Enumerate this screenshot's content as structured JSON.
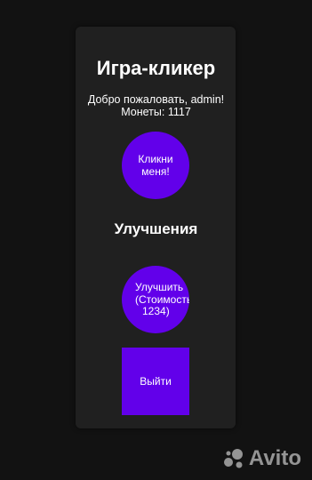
{
  "app": {
    "title": "Игра-кликер",
    "welcome": "Добро пожаловать, admin!",
    "coins_text": "Монеты: 1117"
  },
  "buttons": {
    "click_line1": "Кликни",
    "click_line2": "меня!",
    "upgrade_line1": "Улучшить",
    "upgrade_line2": "(Стоимость:",
    "upgrade_line3": "1234)",
    "logout": "Выйти"
  },
  "sections": {
    "upgrades_heading": "Улучшения"
  },
  "watermark": {
    "brand": "Avito"
  },
  "colors": {
    "background": "#121212",
    "panel": "#202020",
    "accent": "#6200ea"
  }
}
